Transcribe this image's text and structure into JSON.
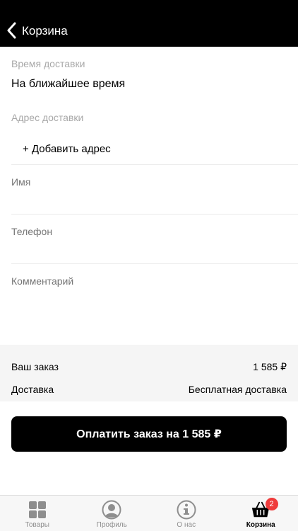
{
  "header": {
    "title": "Корзина",
    "back_icon": "chevron-left-icon"
  },
  "form": {
    "delivery_time": {
      "label": "Время доставки",
      "value": "На ближайшее время"
    },
    "address": {
      "label": "Адрес доставки",
      "add_label": "+ Добавить адрес"
    },
    "name": {
      "placeholder": "Имя"
    },
    "phone": {
      "placeholder": "Телефон"
    },
    "comment": {
      "placeholder": "Комментарий"
    }
  },
  "summary": {
    "order_label": "Ваш заказ",
    "order_value": "1 585 ₽",
    "delivery_label": "Доставка",
    "delivery_value": "Бесплатная доставка"
  },
  "pay_button": {
    "label": "Оплатить заказ на 1 585 ₽"
  },
  "tabbar": {
    "items": [
      {
        "label": "Товары",
        "icon": "grid-icon",
        "active": false
      },
      {
        "label": "Профиль",
        "icon": "profile-icon",
        "active": false
      },
      {
        "label": "О нас",
        "icon": "info-icon",
        "active": false
      },
      {
        "label": "Корзина",
        "icon": "basket-icon",
        "active": true,
        "badge": "2"
      }
    ]
  },
  "colors": {
    "primary": "#000000",
    "badge": "#ef3b3b",
    "muted": "#a8a8a8",
    "summary_bg": "#f5f5f5"
  }
}
